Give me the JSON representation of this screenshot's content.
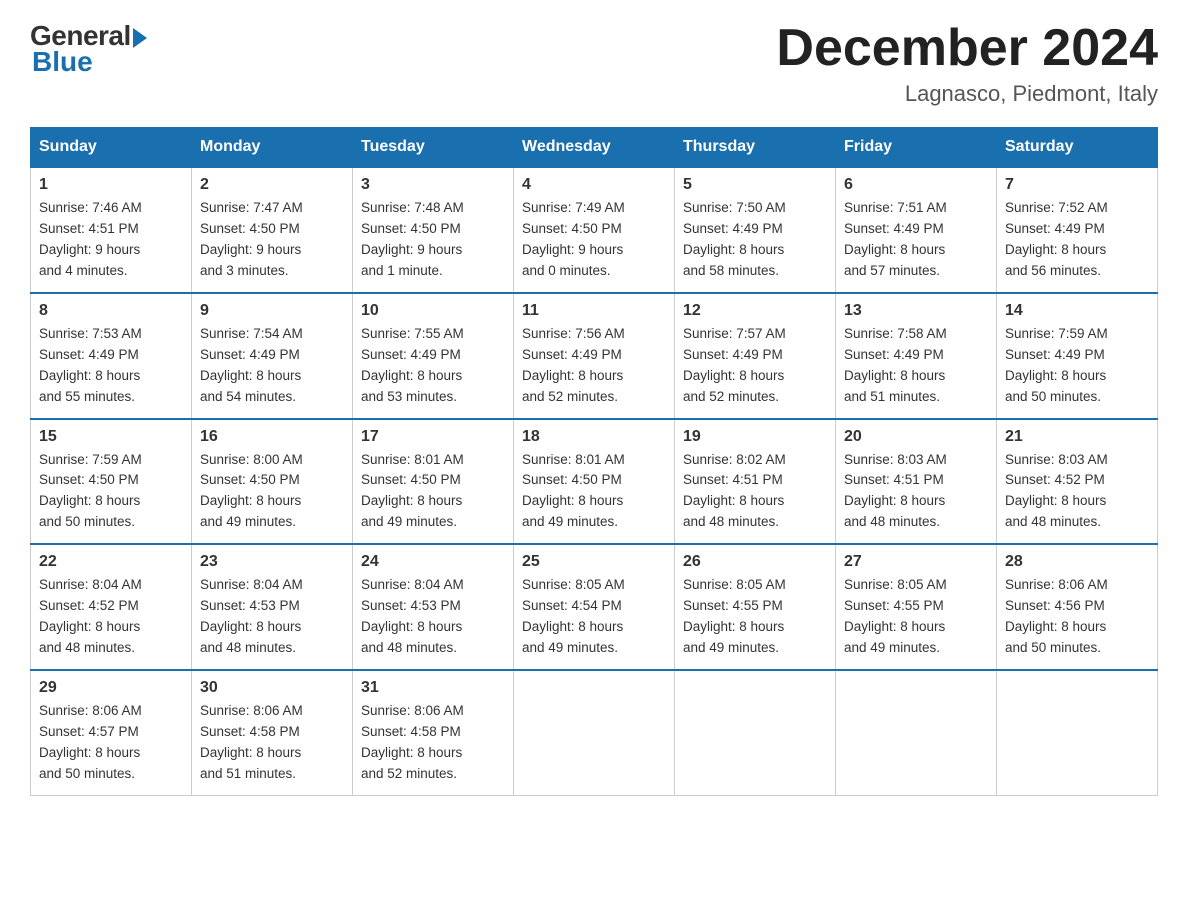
{
  "logo": {
    "general": "General",
    "blue": "Blue"
  },
  "title": "December 2024",
  "location": "Lagnasco, Piedmont, Italy",
  "days_of_week": [
    "Sunday",
    "Monday",
    "Tuesday",
    "Wednesday",
    "Thursday",
    "Friday",
    "Saturday"
  ],
  "weeks": [
    [
      {
        "num": "1",
        "info": "Sunrise: 7:46 AM\nSunset: 4:51 PM\nDaylight: 9 hours\nand 4 minutes."
      },
      {
        "num": "2",
        "info": "Sunrise: 7:47 AM\nSunset: 4:50 PM\nDaylight: 9 hours\nand 3 minutes."
      },
      {
        "num": "3",
        "info": "Sunrise: 7:48 AM\nSunset: 4:50 PM\nDaylight: 9 hours\nand 1 minute."
      },
      {
        "num": "4",
        "info": "Sunrise: 7:49 AM\nSunset: 4:50 PM\nDaylight: 9 hours\nand 0 minutes."
      },
      {
        "num": "5",
        "info": "Sunrise: 7:50 AM\nSunset: 4:49 PM\nDaylight: 8 hours\nand 58 minutes."
      },
      {
        "num": "6",
        "info": "Sunrise: 7:51 AM\nSunset: 4:49 PM\nDaylight: 8 hours\nand 57 minutes."
      },
      {
        "num": "7",
        "info": "Sunrise: 7:52 AM\nSunset: 4:49 PM\nDaylight: 8 hours\nand 56 minutes."
      }
    ],
    [
      {
        "num": "8",
        "info": "Sunrise: 7:53 AM\nSunset: 4:49 PM\nDaylight: 8 hours\nand 55 minutes."
      },
      {
        "num": "9",
        "info": "Sunrise: 7:54 AM\nSunset: 4:49 PM\nDaylight: 8 hours\nand 54 minutes."
      },
      {
        "num": "10",
        "info": "Sunrise: 7:55 AM\nSunset: 4:49 PM\nDaylight: 8 hours\nand 53 minutes."
      },
      {
        "num": "11",
        "info": "Sunrise: 7:56 AM\nSunset: 4:49 PM\nDaylight: 8 hours\nand 52 minutes."
      },
      {
        "num": "12",
        "info": "Sunrise: 7:57 AM\nSunset: 4:49 PM\nDaylight: 8 hours\nand 52 minutes."
      },
      {
        "num": "13",
        "info": "Sunrise: 7:58 AM\nSunset: 4:49 PM\nDaylight: 8 hours\nand 51 minutes."
      },
      {
        "num": "14",
        "info": "Sunrise: 7:59 AM\nSunset: 4:49 PM\nDaylight: 8 hours\nand 50 minutes."
      }
    ],
    [
      {
        "num": "15",
        "info": "Sunrise: 7:59 AM\nSunset: 4:50 PM\nDaylight: 8 hours\nand 50 minutes."
      },
      {
        "num": "16",
        "info": "Sunrise: 8:00 AM\nSunset: 4:50 PM\nDaylight: 8 hours\nand 49 minutes."
      },
      {
        "num": "17",
        "info": "Sunrise: 8:01 AM\nSunset: 4:50 PM\nDaylight: 8 hours\nand 49 minutes."
      },
      {
        "num": "18",
        "info": "Sunrise: 8:01 AM\nSunset: 4:50 PM\nDaylight: 8 hours\nand 49 minutes."
      },
      {
        "num": "19",
        "info": "Sunrise: 8:02 AM\nSunset: 4:51 PM\nDaylight: 8 hours\nand 48 minutes."
      },
      {
        "num": "20",
        "info": "Sunrise: 8:03 AM\nSunset: 4:51 PM\nDaylight: 8 hours\nand 48 minutes."
      },
      {
        "num": "21",
        "info": "Sunrise: 8:03 AM\nSunset: 4:52 PM\nDaylight: 8 hours\nand 48 minutes."
      }
    ],
    [
      {
        "num": "22",
        "info": "Sunrise: 8:04 AM\nSunset: 4:52 PM\nDaylight: 8 hours\nand 48 minutes."
      },
      {
        "num": "23",
        "info": "Sunrise: 8:04 AM\nSunset: 4:53 PM\nDaylight: 8 hours\nand 48 minutes."
      },
      {
        "num": "24",
        "info": "Sunrise: 8:04 AM\nSunset: 4:53 PM\nDaylight: 8 hours\nand 48 minutes."
      },
      {
        "num": "25",
        "info": "Sunrise: 8:05 AM\nSunset: 4:54 PM\nDaylight: 8 hours\nand 49 minutes."
      },
      {
        "num": "26",
        "info": "Sunrise: 8:05 AM\nSunset: 4:55 PM\nDaylight: 8 hours\nand 49 minutes."
      },
      {
        "num": "27",
        "info": "Sunrise: 8:05 AM\nSunset: 4:55 PM\nDaylight: 8 hours\nand 49 minutes."
      },
      {
        "num": "28",
        "info": "Sunrise: 8:06 AM\nSunset: 4:56 PM\nDaylight: 8 hours\nand 50 minutes."
      }
    ],
    [
      {
        "num": "29",
        "info": "Sunrise: 8:06 AM\nSunset: 4:57 PM\nDaylight: 8 hours\nand 50 minutes."
      },
      {
        "num": "30",
        "info": "Sunrise: 8:06 AM\nSunset: 4:58 PM\nDaylight: 8 hours\nand 51 minutes."
      },
      {
        "num": "31",
        "info": "Sunrise: 8:06 AM\nSunset: 4:58 PM\nDaylight: 8 hours\nand 52 minutes."
      },
      {
        "num": "",
        "info": ""
      },
      {
        "num": "",
        "info": ""
      },
      {
        "num": "",
        "info": ""
      },
      {
        "num": "",
        "info": ""
      }
    ]
  ]
}
